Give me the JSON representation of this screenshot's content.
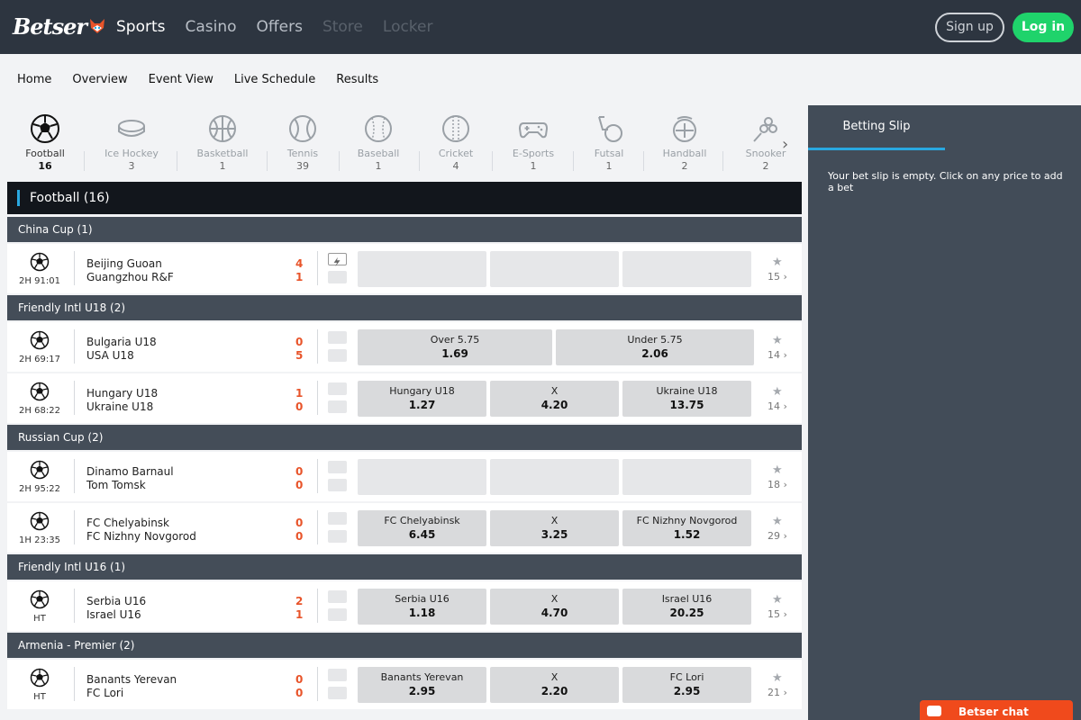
{
  "brand": {
    "name": "Betser"
  },
  "header": {
    "nav": [
      "Sports",
      "Casino",
      "Offers",
      "Store",
      "Locker"
    ],
    "signup": "Sign up",
    "login": "Log in"
  },
  "subnav": [
    "Home",
    "Overview",
    "Event View",
    "Live Schedule",
    "Results"
  ],
  "sports": [
    {
      "name": "Football",
      "count": "16",
      "icon": "football-icon"
    },
    {
      "name": "Ice Hockey",
      "count": "3",
      "icon": "hockey-puck-icon"
    },
    {
      "name": "Basketball",
      "count": "1",
      "icon": "basketball-icon"
    },
    {
      "name": "Tennis",
      "count": "39",
      "icon": "tennis-ball-icon"
    },
    {
      "name": "Baseball",
      "count": "1",
      "icon": "baseball-icon"
    },
    {
      "name": "Cricket",
      "count": "4",
      "icon": "cricket-ball-icon"
    },
    {
      "name": "E-Sports",
      "count": "1",
      "icon": "gamepad-icon"
    },
    {
      "name": "Futsal",
      "count": "1",
      "icon": "futsal-icon"
    },
    {
      "name": "Handball",
      "count": "2",
      "icon": "handball-icon"
    },
    {
      "name": "Snooker",
      "count": "2",
      "icon": "snooker-icon"
    }
  ],
  "section_title": "Football (16)",
  "leagues": [
    {
      "name": "China Cup  (1)",
      "events": [
        {
          "clock": "2H 91:01",
          "home": "Beijing Guoan",
          "away": "Guangzhou R&F",
          "home_score": "4",
          "away_score": "1",
          "live_flash": true,
          "more": "15",
          "layout": "three-empty",
          "odds": []
        }
      ]
    },
    {
      "name": "Friendly Intl U18  (2)",
      "events": [
        {
          "clock": "2H 69:17",
          "home": "Bulgaria U18",
          "away": "USA U18",
          "home_score": "0",
          "away_score": "5",
          "more": "14",
          "layout": "two",
          "odds": [
            {
              "label": "Over  5.75",
              "price": "1.69"
            },
            {
              "label": "Under  5.75",
              "price": "2.06"
            }
          ]
        },
        {
          "clock": "2H 68:22",
          "home": "Hungary U18",
          "away": "Ukraine U18",
          "home_score": "1",
          "away_score": "0",
          "more": "14",
          "layout": "three",
          "odds": [
            {
              "label": "Hungary U18",
              "price": "1.27"
            },
            {
              "label": "X",
              "price": "4.20"
            },
            {
              "label": "Ukraine U18",
              "price": "13.75"
            }
          ]
        }
      ]
    },
    {
      "name": "Russian Cup  (2)",
      "events": [
        {
          "clock": "2H 95:22",
          "home": "Dinamo Barnaul",
          "away": "Tom Tomsk",
          "home_score": "0",
          "away_score": "0",
          "more": "18",
          "layout": "three-empty",
          "odds": []
        },
        {
          "clock": "1H 23:35",
          "home": "FC Chelyabinsk",
          "away": "FC Nizhny Novgorod",
          "home_score": "0",
          "away_score": "0",
          "more": "29",
          "layout": "three",
          "odds": [
            {
              "label": "FC Chelyabinsk",
              "price": "6.45"
            },
            {
              "label": "X",
              "price": "3.25"
            },
            {
              "label": "FC Nizhny Novgorod",
              "price": "1.52"
            }
          ]
        }
      ]
    },
    {
      "name": "Friendly Intl U16  (1)",
      "events": [
        {
          "clock": "HT",
          "home": "Serbia U16",
          "away": "Israel U16",
          "home_score": "2",
          "away_score": "1",
          "more": "15",
          "layout": "three",
          "odds": [
            {
              "label": "Serbia U16",
              "price": "1.18"
            },
            {
              "label": "X",
              "price": "4.70"
            },
            {
              "label": "Israel U16",
              "price": "20.25"
            }
          ]
        }
      ]
    },
    {
      "name": "Armenia - Premier  (2)",
      "events": [
        {
          "clock": "HT",
          "home": "Banants Yerevan",
          "away": "FC Lori",
          "home_score": "0",
          "away_score": "0",
          "more": "21",
          "layout": "three",
          "odds": [
            {
              "label": "Banants Yerevan",
              "price": "2.95"
            },
            {
              "label": "X",
              "price": "2.20"
            },
            {
              "label": "FC Lori",
              "price": "2.95"
            }
          ]
        }
      ]
    }
  ],
  "slip": {
    "title": "Betting Slip",
    "empty_message": "Your bet slip is empty. Click on any price to add a bet"
  },
  "chat": {
    "label": "Betser chat"
  },
  "colors": {
    "header_bg": "#2d3540",
    "accent_green": "#1fd36b",
    "accent_blue": "#29a8e0",
    "score_red": "#e8542a",
    "chat_orange": "#f04a1c",
    "league_bg": "#444d58",
    "slip_bg": "#424c58"
  }
}
